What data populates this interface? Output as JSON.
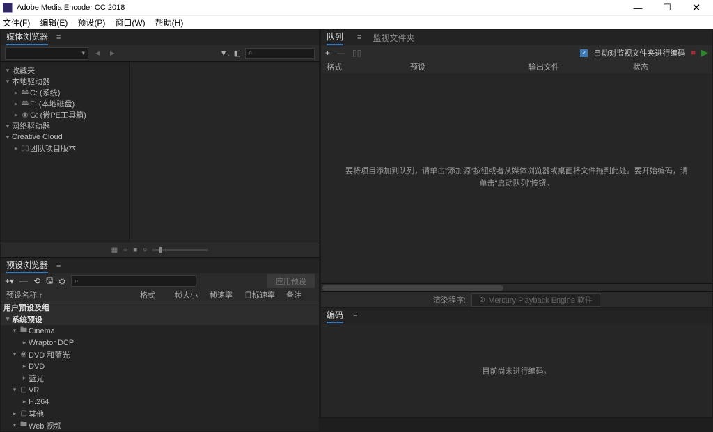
{
  "title": "Adobe Media Encoder CC 2018",
  "menu": {
    "file": "文件(F)",
    "edit": "编辑(E)",
    "preset": "预设(P)",
    "window": "窗口(W)",
    "help": "帮助(H)"
  },
  "window_controls": {
    "minimize": "—",
    "maximize": "☐",
    "close": "✕"
  },
  "media_browser": {
    "title": "媒体浏览器",
    "search_placeholder": "⌕",
    "tree": {
      "favorites": "收藏夹",
      "local_drives": "本地驱动器",
      "c": "C: (系统)",
      "f": "F: (本地磁盘)",
      "g": "G: (微PE工具箱)",
      "network_drives": "网络驱动器",
      "creative_cloud": "Creative Cloud",
      "team_project": "团队项目版本"
    }
  },
  "preset_browser": {
    "title": "预设浏览器",
    "apply": "应用预设",
    "search_placeholder": "⌕",
    "columns": {
      "name": "预设名称 ↑",
      "format": "格式",
      "fsize": "帧大小",
      "frate": "帧速率",
      "trate": "目标速率",
      "comment": "备注"
    },
    "groups": {
      "user": "用户预设及组",
      "system": "系统预设",
      "cinema": "Cinema",
      "wraptor": "Wraptor DCP",
      "dvd_bluray": "DVD 和蓝光",
      "dvd": "DVD",
      "bluray": "蓝光",
      "vr": "VR",
      "h264": "H.264",
      "other": "其他",
      "web": "Web 视频"
    }
  },
  "queue": {
    "tab_queue": "队列",
    "tab_watch": "监视文件夹",
    "auto_watch": "自动对监视文件夹进行编码",
    "columns": {
      "format": "格式",
      "preset": "预设",
      "output": "输出文件",
      "status": "状态"
    },
    "placeholder": "要将项目添加到队列，请单击\"添加源\"按钮或者从媒体浏览器或桌面将文件拖到此处。要开始编码，请单击\"启动队列\"按钮。",
    "render_label": "渲染程序:",
    "render_engine": "Mercury Playback Engine 软件"
  },
  "encoding": {
    "title": "编码",
    "message": "目前尚未进行编码。"
  }
}
